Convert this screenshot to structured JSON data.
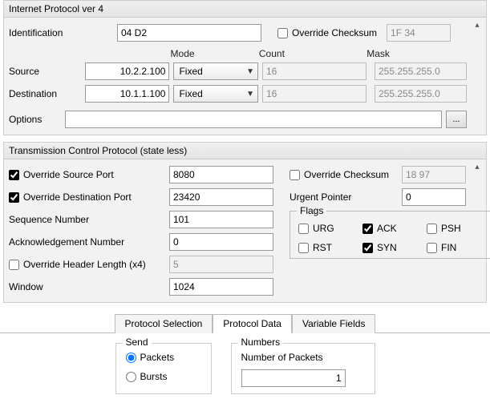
{
  "ip": {
    "title": "Internet Protocol ver 4",
    "identification_label": "Identification",
    "identification_value": "04 D2",
    "override_checksum_label": "Override Checksum",
    "override_checksum_checked": false,
    "checksum_value": "1F 34",
    "columns": {
      "mode": "Mode",
      "count": "Count",
      "mask": "Mask"
    },
    "source_label": "Source",
    "source_addr": "10.2.2.100",
    "source_mode": "Fixed",
    "source_count": "16",
    "source_mask": "255.255.255.0",
    "destination_label": "Destination",
    "destination_addr": "10.1.1.100",
    "destination_mode": "Fixed",
    "destination_count": "16",
    "destination_mask": "255.255.255.0",
    "options_label": "Options",
    "options_value": "",
    "options_button": "..."
  },
  "tcp": {
    "title": "Transmission Control Protocol (state less)",
    "override_source_port_label": "Override Source Port",
    "override_source_port_checked": true,
    "source_port": "8080",
    "override_dest_port_label": "Override Destination Port",
    "override_dest_port_checked": true,
    "dest_port": "23420",
    "sequence_number_label": "Sequence Number",
    "sequence_number": "101",
    "ack_number_label": "Acknowledgement Number",
    "ack_number": "0",
    "override_header_len_label": "Override Header Length (x4)",
    "override_header_len_checked": false,
    "header_len": "5",
    "window_label": "Window",
    "window": "1024",
    "override_checksum_label": "Override Checksum",
    "override_checksum_checked": false,
    "checksum_value": "18 97",
    "urgent_pointer_label": "Urgent Pointer",
    "urgent_pointer": "0",
    "flags_label": "Flags",
    "flags": {
      "URG": {
        "label": "URG",
        "checked": false
      },
      "ACK": {
        "label": "ACK",
        "checked": true
      },
      "PSH": {
        "label": "PSH",
        "checked": false
      },
      "RST": {
        "label": "RST",
        "checked": false
      },
      "SYN": {
        "label": "SYN",
        "checked": true
      },
      "FIN": {
        "label": "FIN",
        "checked": false
      }
    }
  },
  "tabs": {
    "protocol_selection": "Protocol Selection",
    "protocol_data": "Protocol Data",
    "variable_fields": "Variable Fields"
  },
  "send": {
    "group": "Send",
    "packets_label": "Packets",
    "packets_selected": true,
    "bursts_label": "Bursts",
    "bursts_selected": false
  },
  "numbers": {
    "group": "Numbers",
    "number_of_packets_label": "Number of Packets",
    "number_of_packets_value": "1"
  }
}
